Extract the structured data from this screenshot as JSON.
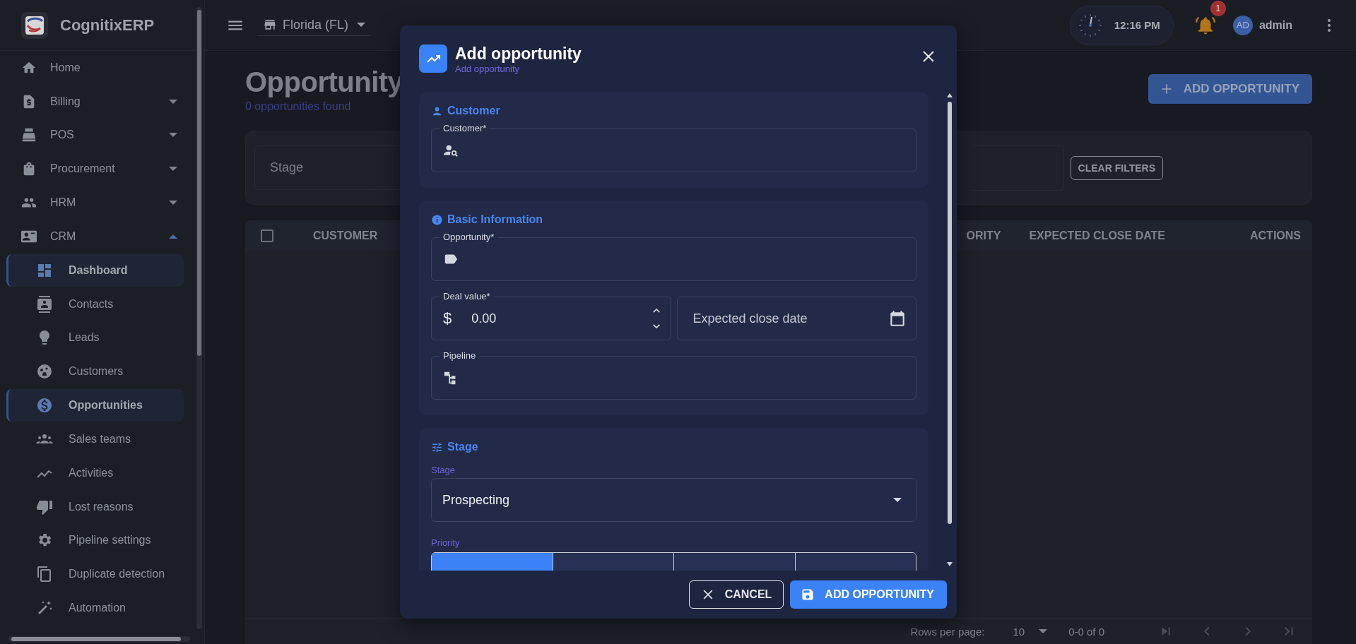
{
  "app": {
    "name": "CognitixERP"
  },
  "sidebar": {
    "items": [
      {
        "label": "Home"
      },
      {
        "label": "Billing",
        "expanded": false
      },
      {
        "label": "POS",
        "expanded": false
      },
      {
        "label": "Procurement",
        "expanded": false
      },
      {
        "label": "HRM",
        "expanded": false
      },
      {
        "label": "CRM",
        "expanded": true,
        "children": [
          {
            "label": "Dashboard",
            "selected": true
          },
          {
            "label": "Contacts",
            "selected": false
          },
          {
            "label": "Leads",
            "selected": false
          },
          {
            "label": "Customers",
            "selected": false
          },
          {
            "label": "Opportunities",
            "selected": true
          },
          {
            "label": "Sales teams",
            "selected": false
          },
          {
            "label": "Activities",
            "selected": false
          },
          {
            "label": "Lost reasons",
            "selected": false
          },
          {
            "label": "Pipeline settings",
            "selected": false
          },
          {
            "label": "Duplicate detection",
            "selected": false
          },
          {
            "label": "Automation",
            "selected": false
          }
        ]
      }
    ]
  },
  "topbar": {
    "location": "Florida (FL)",
    "time": "12:16 PM",
    "notifications": "1",
    "avatar_initials": "AD",
    "user": "admin"
  },
  "page": {
    "title": "Opportunity",
    "subtitle": "0 opportunities found",
    "add_button": "ADD OPPORTUNITY",
    "filters": {
      "stage_placeholder": "Stage",
      "clear_button": "CLEAR FILTERS"
    },
    "table": {
      "select_all_checked": false,
      "columns": [
        "CUSTOMER",
        "ORITY",
        "EXPECTED CLOSE DATE",
        "ACTIONS"
      ]
    },
    "pagination": {
      "rows_per_page_label": "Rows per page:",
      "rows_per_page": "10",
      "range": "0-0 of 0"
    }
  },
  "modal": {
    "title": "Add opportunity",
    "subtitle": "Add opportunity",
    "sections": [
      {
        "title": "Customer",
        "fields": [
          {
            "kind": "search",
            "label": "Customer*"
          }
        ]
      },
      {
        "title": "Basic Information",
        "fields": [
          {
            "kind": "text",
            "label": "Opportunity*"
          },
          {
            "kind": "row",
            "fields": [
              {
                "kind": "number",
                "label": "Deal value*",
                "prefix": "$",
                "value": "0.00"
              },
              {
                "kind": "date",
                "placeholder": "Expected close date"
              }
            ]
          },
          {
            "kind": "tree",
            "label": "Pipeline"
          }
        ]
      },
      {
        "title": "Stage",
        "fields": [
          {
            "kind": "select",
            "label": "Stage",
            "value": "Prospecting"
          },
          {
            "kind": "toggle",
            "label": "Priority",
            "options": [
              {
                "selected": true
              },
              {
                "selected": false
              },
              {
                "selected": false
              },
              {
                "selected": false
              }
            ]
          }
        ]
      }
    ],
    "buttons": [
      {
        "kind": "secondary",
        "label": "CANCEL"
      },
      {
        "kind": "primary",
        "label": "ADD OPPORTUNITY"
      }
    ]
  }
}
